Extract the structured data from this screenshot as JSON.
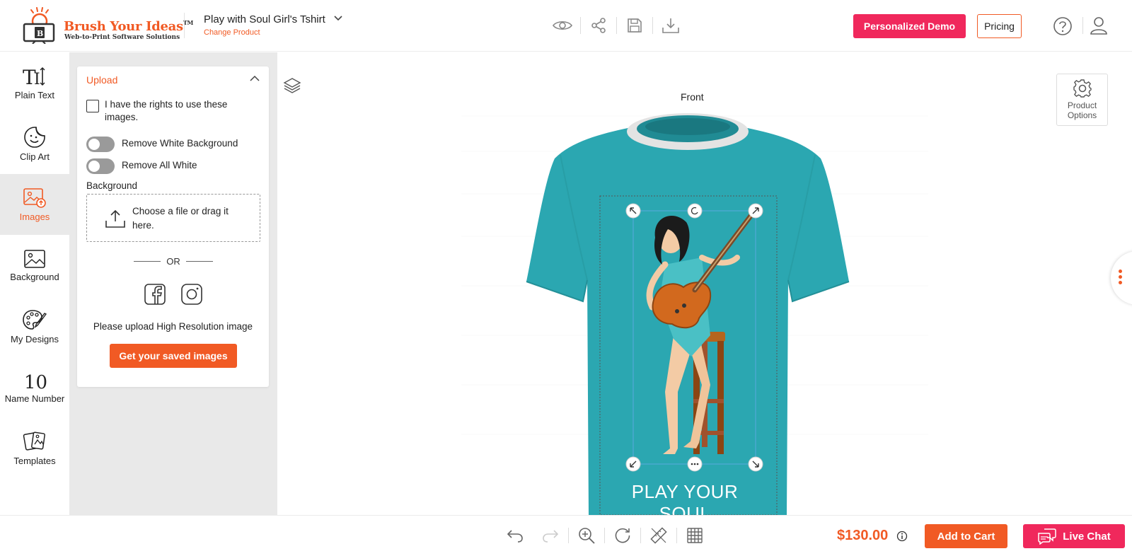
{
  "brand": {
    "name": "Brush Your Ideas",
    "trademark": "TM",
    "tagline": "Web-to-Print Software Solutions"
  },
  "header": {
    "product_name": "Play with Soul Girl's Tshirt",
    "change_product": "Change Product",
    "tools": [
      "eye-icon",
      "share-icon",
      "save-icon",
      "download-icon"
    ],
    "demo_button": "Personalized Demo",
    "pricing_button": "Pricing"
  },
  "sidebar": {
    "items": [
      {
        "label": "Plain Text",
        "icon": "text-icon"
      },
      {
        "label": "Clip Art",
        "icon": "sticker-icon"
      },
      {
        "label": "Images",
        "icon": "image-upload-icon",
        "active": true
      },
      {
        "label": "Background",
        "icon": "background-image-icon"
      },
      {
        "label": "My Designs",
        "icon": "palette-icon"
      },
      {
        "label": "Name Number",
        "icon": "number-icon",
        "glyph": "10"
      },
      {
        "label": "Templates",
        "icon": "templates-icon"
      }
    ]
  },
  "upload_panel": {
    "title": "Upload",
    "rights_checkbox_label": "I have the rights to use these images.",
    "rights_checked": false,
    "toggles": [
      {
        "label": "Remove White Background",
        "on": false
      },
      {
        "label": "Remove All White",
        "on": false
      }
    ],
    "background_label": "Background",
    "dropzone_text": "Choose a file or drag it here.",
    "or_text": "OR",
    "hires_text": "Please upload High Resolution image",
    "saved_images_button": "Get your saved images"
  },
  "canvas": {
    "view_label": "Front",
    "product_options_label": "Product Options",
    "design_text": "PLAY YOUR SOUL",
    "shirt_color": "#2ba7b1"
  },
  "footer": {
    "tools": [
      "undo-icon",
      "redo-icon",
      "zoom-in-icon",
      "reset-icon",
      "ruler-icon",
      "grid-icon"
    ],
    "price": "$130.00",
    "add_to_cart": "Add to Cart",
    "live_chat": "Live Chat"
  },
  "colors": {
    "accent_orange": "#f15a24",
    "accent_pink": "#f0285c"
  }
}
